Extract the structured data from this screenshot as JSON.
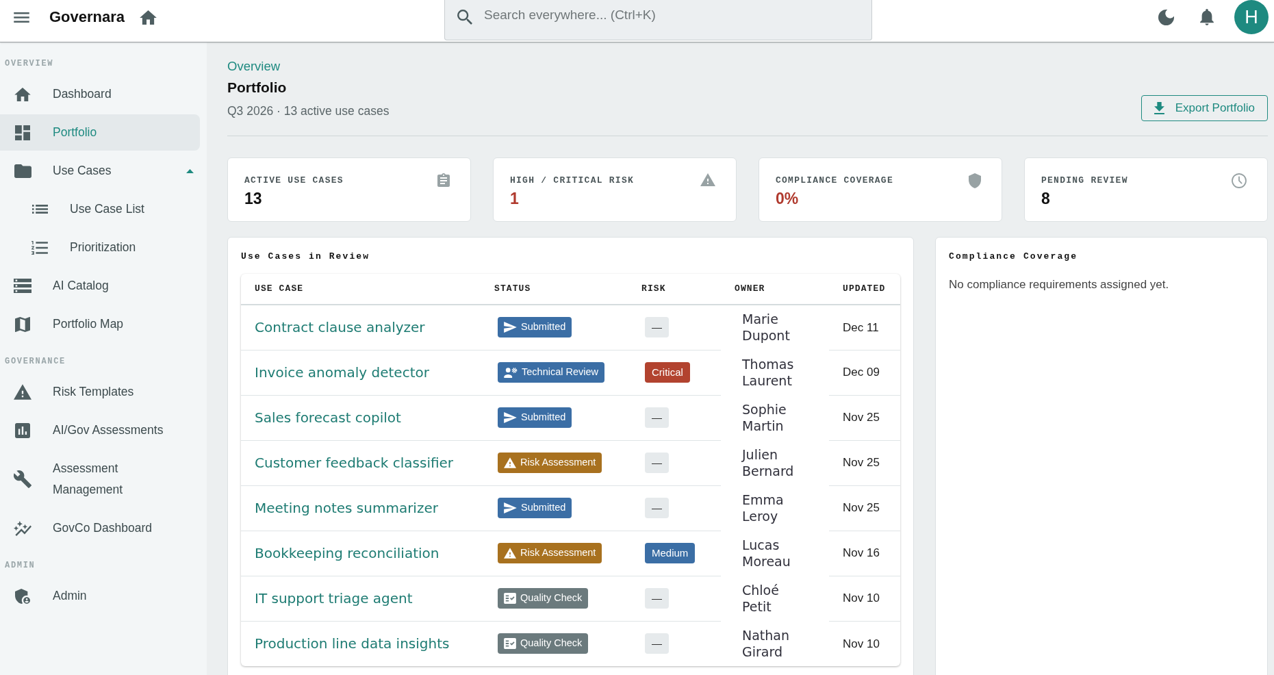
{
  "top_bar": {
    "brand": "Governara",
    "search": {
      "placeholder": "Search everywhere... (Ctrl+K)"
    },
    "avatar": "H"
  },
  "sidebar": {
    "sections": [
      {
        "title": "OVERVIEW",
        "items": [
          {
            "label": "Dashboard",
            "selected": false
          },
          {
            "label": "Portfolio",
            "selected": true
          },
          {
            "label": "Use Cases",
            "selected": false,
            "expanded": true,
            "children": [
              {
                "label": "Use Case List",
                "selected": false
              },
              {
                "label": "Prioritization",
                "selected": false
              }
            ]
          },
          {
            "label": "AI Catalog",
            "selected": false
          },
          {
            "label": "Portfolio Map",
            "selected": false
          }
        ]
      },
      {
        "title": "GOVERNANCE",
        "items": [
          {
            "label": "Risk Templates",
            "selected": false
          },
          {
            "label": "AI/Gov Assessments",
            "selected": false
          },
          {
            "label": "Assessment Management",
            "selected": false
          },
          {
            "label": "GovCo Dashboard",
            "selected": false
          }
        ]
      },
      {
        "title": "ADMIN",
        "items": [
          {
            "label": "Admin",
            "selected": false
          }
        ]
      }
    ]
  },
  "header": {
    "breadcrumb": "Overview",
    "title": "Portfolio",
    "subtitle": "Q3 2026 · 13 active use cases",
    "export_button": "Export Portfolio"
  },
  "stats": [
    {
      "label": "ACTIVE USE CASES",
      "value": "13",
      "alert": false
    },
    {
      "label": "HIGH / CRITICAL RISK",
      "value": "1",
      "alert": true
    },
    {
      "label": "COMPLIANCE COVERAGE",
      "value": "0%",
      "alert": true
    },
    {
      "label": "PENDING REVIEW",
      "value": "8",
      "alert": false
    }
  ],
  "review_table": {
    "title": "Use Cases in Review",
    "columns": [
      "USE CASE",
      "STATUS",
      "RISK",
      "OWNER",
      "UPDATED"
    ],
    "rows": [
      {
        "use_case": "Contract clause analyzer",
        "status": {
          "label": "Submitted",
          "kind": "submitted"
        },
        "risk": {
          "label": "—",
          "kind": "none"
        },
        "owner": "Marie Dupont",
        "updated": "Dec 11"
      },
      {
        "use_case": "Invoice anomaly detector",
        "status": {
          "label": "Technical Review",
          "kind": "review"
        },
        "risk": {
          "label": "Critical",
          "kind": "critical"
        },
        "owner": "Thomas Laurent",
        "updated": "Dec 09"
      },
      {
        "use_case": "Sales forecast copilot",
        "status": {
          "label": "Submitted",
          "kind": "submitted"
        },
        "risk": {
          "label": "—",
          "kind": "none"
        },
        "owner": "Sophie Martin",
        "updated": "Nov 25"
      },
      {
        "use_case": "Customer feedback classifier",
        "status": {
          "label": "Risk Assessment",
          "kind": "assessment"
        },
        "risk": {
          "label": "—",
          "kind": "none"
        },
        "owner": "Julien Bernard",
        "updated": "Nov 25"
      },
      {
        "use_case": "Meeting notes summarizer",
        "status": {
          "label": "Submitted",
          "kind": "submitted"
        },
        "risk": {
          "label": "—",
          "kind": "none"
        },
        "owner": "Emma Leroy",
        "updated": "Nov 25"
      },
      {
        "use_case": "Bookkeeping reconciliation",
        "status": {
          "label": "Risk Assessment",
          "kind": "assessment"
        },
        "risk": {
          "label": "Medium",
          "kind": "medium"
        },
        "owner": "Lucas Moreau",
        "updated": "Nov 16"
      },
      {
        "use_case": "IT support triage agent",
        "status": {
          "label": "Quality Check",
          "kind": "check"
        },
        "risk": {
          "label": "—",
          "kind": "none"
        },
        "owner": "Chloé Petit",
        "updated": "Nov 10"
      },
      {
        "use_case": "Production line data insights",
        "status": {
          "label": "Quality Check",
          "kind": "check"
        },
        "risk": {
          "label": "—",
          "kind": "none"
        },
        "owner": "Nathan Girard",
        "updated": "Nov 10"
      }
    ]
  },
  "compliance_panel": {
    "title": "Compliance Coverage",
    "empty_message": "No compliance requirements assigned yet."
  }
}
